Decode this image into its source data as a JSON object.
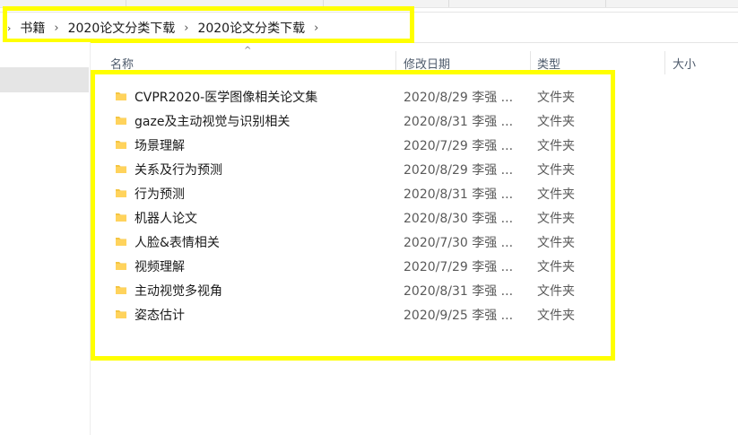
{
  "breadcrumb": {
    "items": [
      "书籍",
      "2020论文分类下载",
      "2020论文分类下载"
    ],
    "separator": "›",
    "leading": "›"
  },
  "columns": {
    "name": "名称",
    "date": "修改日期",
    "type": "类型",
    "size": "大小"
  },
  "rows": [
    {
      "name": "CVPR2020-医学图像相关论文集",
      "date": "2020/8/29 李强 ...",
      "type": "文件夹"
    },
    {
      "name": "gaze及主动视觉与识别相关",
      "date": "2020/8/31 李强 ...",
      "type": "文件夹"
    },
    {
      "name": "场景理解",
      "date": "2020/7/29 李强 ...",
      "type": "文件夹"
    },
    {
      "name": "关系及行为预测",
      "date": "2020/8/29 李强 ...",
      "type": "文件夹"
    },
    {
      "name": "行为预测",
      "date": "2020/8/31 李强 ...",
      "type": "文件夹"
    },
    {
      "name": "机器人论文",
      "date": "2020/8/30 李强 ...",
      "type": "文件夹"
    },
    {
      "name": "人脸&表情相关",
      "date": "2020/7/30 李强 ...",
      "type": "文件夹"
    },
    {
      "name": "视频理解",
      "date": "2020/7/29 李强 ...",
      "type": "文件夹"
    },
    {
      "name": "主动视觉多视角",
      "date": "2020/8/31 李强 ...",
      "type": "文件夹"
    },
    {
      "name": "姿态估计",
      "date": "2020/9/25 李强 ...",
      "type": "文件夹"
    }
  ],
  "icons": {
    "folder": "folder-icon",
    "sort": "sort-up-icon"
  },
  "colors": {
    "highlight": "#ffff00",
    "folder": "#f4c542",
    "selected_nav": "#e5e5e5"
  }
}
